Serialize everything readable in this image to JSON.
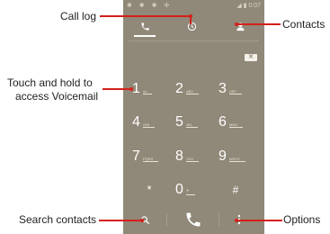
{
  "callouts": {
    "call_log": "Call log",
    "contacts": "Contacts",
    "voicemail_line1": "Touch and hold to",
    "voicemail_line2": "access Voicemail",
    "search_contacts": "Search contacts",
    "options": "Options"
  },
  "status_bar": {
    "time": "0:07"
  },
  "tabs": [
    {
      "icon": "phone-icon",
      "selected": true
    },
    {
      "icon": "clock-icon",
      "selected": false
    },
    {
      "icon": "person-icon",
      "selected": false
    }
  ],
  "delete_label": "✕",
  "keypad": [
    {
      "digit": "1",
      "letters": "oo"
    },
    {
      "digit": "2",
      "letters": "ABC"
    },
    {
      "digit": "3",
      "letters": "DEF"
    },
    {
      "digit": "4",
      "letters": "GHI"
    },
    {
      "digit": "5",
      "letters": "JKL"
    },
    {
      "digit": "6",
      "letters": "MNO"
    },
    {
      "digit": "7",
      "letters": "PQRS"
    },
    {
      "digit": "8",
      "letters": "TUV"
    },
    {
      "digit": "9",
      "letters": "WXYZ"
    },
    {
      "digit": "*",
      "letters": ""
    },
    {
      "digit": "0",
      "letters": "+"
    },
    {
      "digit": "#",
      "letters": ""
    }
  ],
  "bottom_bar": {
    "search_icon": "search-icon",
    "call_icon": "phone-call-icon",
    "options_icon": "more-vert-icon"
  },
  "colors": {
    "screen": "#908878",
    "callout_line": "#d4201a"
  }
}
